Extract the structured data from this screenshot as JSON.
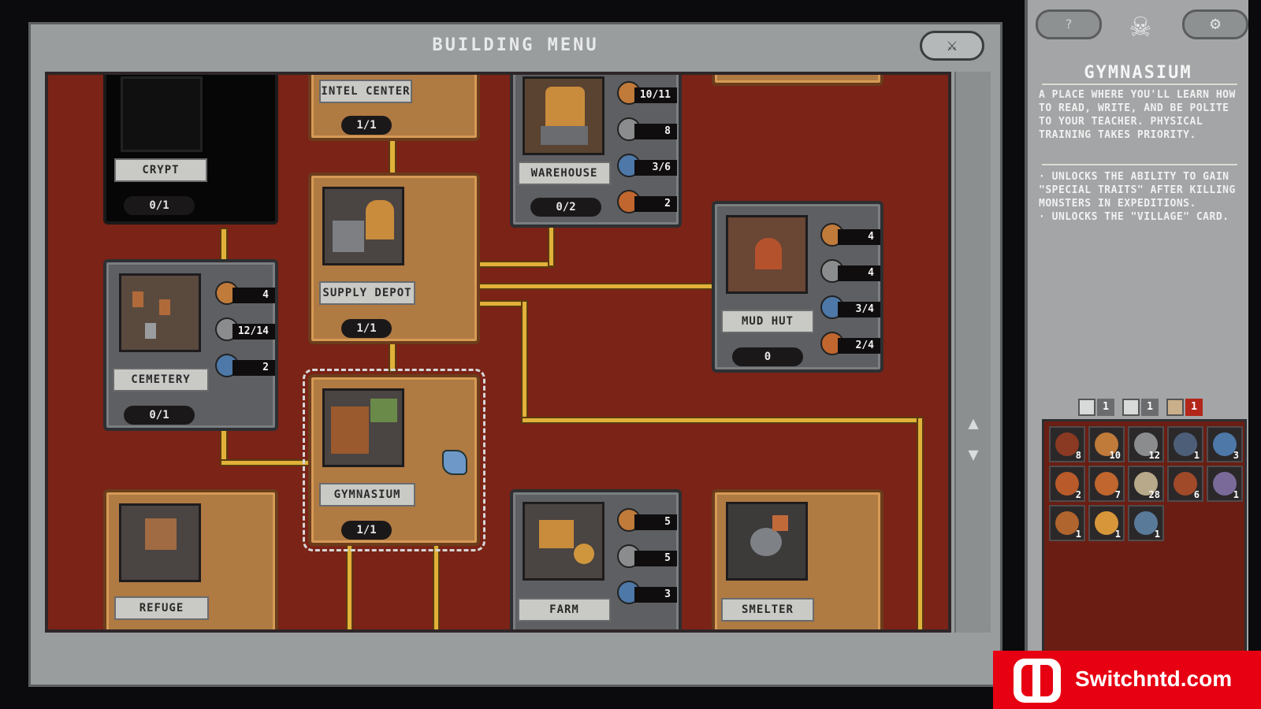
{
  "menu": {
    "title": "BUILDING MENU",
    "close_icon": "crossed-swords-icon"
  },
  "board": {
    "buildings": {
      "crypt": {
        "name": "CRYPT",
        "count": "0/1"
      },
      "intel_center": {
        "name": "INTEL CENTER",
        "count": "1/1"
      },
      "warehouse": {
        "name": "WAREHOUSE",
        "count": "0/2",
        "res": [
          "10/11",
          "8",
          "3/6",
          "2"
        ]
      },
      "supply_depot": {
        "name": "SUPPLY DEPOT",
        "count": "1/1"
      },
      "mud_hut": {
        "name": "MUD HUT",
        "count": "0",
        "res": [
          "4",
          "4",
          "3/4",
          "2/4"
        ]
      },
      "cemetery": {
        "name": "CEMETERY",
        "count": "0/1",
        "res": [
          "4",
          "12/14",
          "2"
        ]
      },
      "gymnasium": {
        "name": "GYMNASIUM",
        "count": "1/1"
      },
      "refuge": {
        "name": "REFUGE"
      },
      "farm": {
        "name": "FARM",
        "res": [
          "5",
          "5",
          "3"
        ]
      },
      "smelter": {
        "name": "SMELTER"
      }
    }
  },
  "side_panel": {
    "help_label": "?",
    "settings_icon": "gear-icon",
    "building_name": "GYMNASIUM",
    "description": "A PLACE WHERE YOU'LL LEARN HOW TO READ, WRITE, AND BE POLITE TO YOUR TEACHER. PHYSICAL TRAINING TAKES PRIORITY.",
    "effects": [
      "· UNLOCKS THE ABILITY TO GAIN \"SPECIAL TRAITS\" AFTER KILLING MONSTERS IN EXPEDITIONS.",
      "· UNLOCKS THE \"VILLAGE\" CARD."
    ],
    "stats": [
      "1",
      "1",
      "1"
    ],
    "inventory": [
      "8",
      "10",
      "12",
      "1",
      "3",
      "2",
      "7",
      "28",
      "6",
      "1",
      "1",
      "1",
      "1"
    ]
  },
  "watermark": {
    "text": "Switchntd.com"
  },
  "colors": {
    "board": "#7a2316",
    "road": "#e0b23a",
    "panel": "#a3a5a6",
    "accent_red": "#ff4b3e"
  }
}
